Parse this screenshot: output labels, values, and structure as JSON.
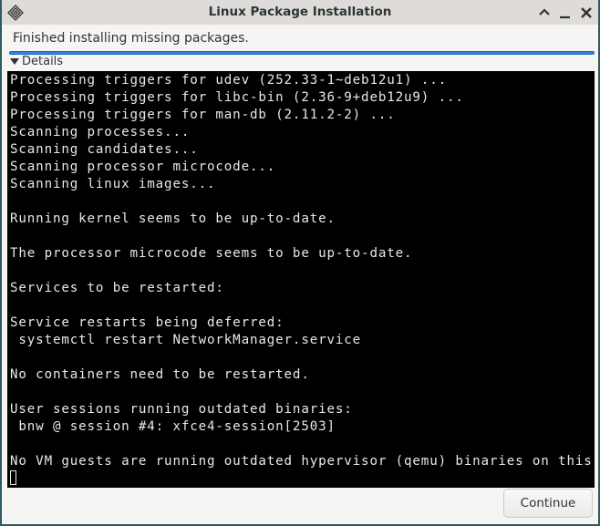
{
  "window": {
    "title": "Linux Package Installation"
  },
  "status_text": "Finished installing missing packages.",
  "progress": 1.0,
  "details_label": "Details",
  "terminal_lines": [
    "Processing triggers for udev (252.33-1~deb12u1) ...",
    "Processing triggers for libc-bin (2.36-9+deb12u9) ...",
    "Processing triggers for man-db (2.11.2-2) ...",
    "Scanning processes...",
    "Scanning candidates...",
    "Scanning processor microcode...",
    "Scanning linux images...",
    "",
    "Running kernel seems to be up-to-date.",
    "",
    "The processor microcode seems to be up-to-date.",
    "",
    "Services to be restarted:",
    "",
    "Service restarts being deferred:",
    " systemctl restart NetworkManager.service",
    "",
    "No containers need to be restarted.",
    "",
    "User sessions running outdated binaries:",
    " bnw @ session #4: xfce4-session[2503]",
    "",
    "No VM guests are running outdated hypervisor (qemu) binaries on this host."
  ],
  "continue_label": "Continue"
}
